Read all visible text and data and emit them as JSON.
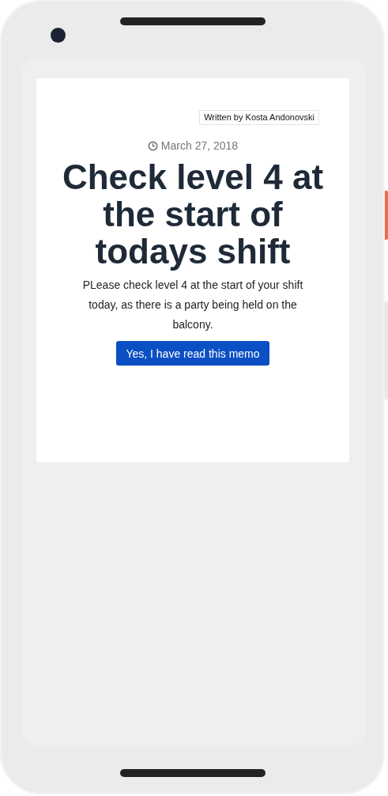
{
  "memo": {
    "author": "Written by Kosta Andonovski",
    "date": "March 27, 2018",
    "title": "Check level 4 at the start of todays shift",
    "body": "PLease check level 4 at the start of your shift today, as there is a party being held on the balcony.",
    "button": "Yes, I have read this memo"
  }
}
